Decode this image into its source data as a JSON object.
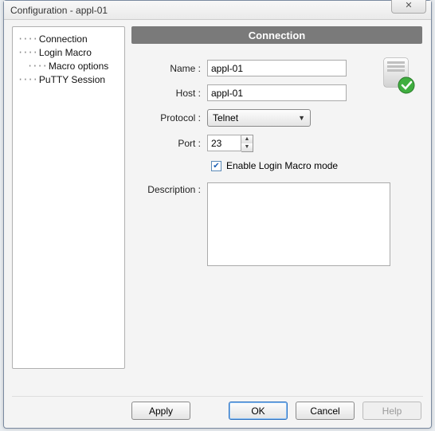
{
  "window": {
    "title": "Configuration - appl-01"
  },
  "tree": {
    "items": [
      {
        "label": "Connection",
        "indent": 0
      },
      {
        "label": "Login Macro",
        "indent": 0
      },
      {
        "label": "Macro options",
        "indent": 1
      },
      {
        "label": "PuTTY Session",
        "indent": 0
      }
    ]
  },
  "section": {
    "title": "Connection"
  },
  "form": {
    "name_label": "Name :",
    "name_value": "appl-01",
    "host_label": "Host :",
    "host_value": "appl-01",
    "protocol_label": "Protocol :",
    "protocol_value": "Telnet",
    "port_label": "Port :",
    "port_value": "23",
    "enable_login_macro_label": "Enable Login Macro mode",
    "enable_login_macro_checked": true,
    "description_label": "Description :",
    "description_value": ""
  },
  "buttons": {
    "apply": "Apply",
    "ok": "OK",
    "cancel": "Cancel",
    "help": "Help"
  }
}
